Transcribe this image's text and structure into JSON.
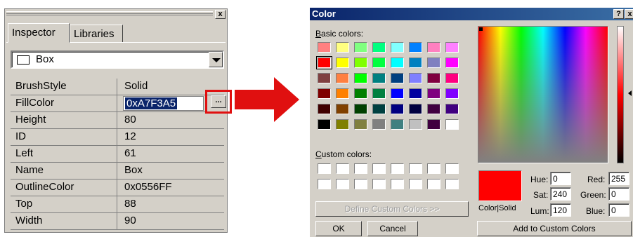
{
  "inspector": {
    "close_glyph": "x",
    "tabs": [
      {
        "label": "Inspector",
        "active": true
      },
      {
        "label": "Libraries",
        "active": false
      }
    ],
    "object_selector": {
      "value": "Box",
      "icon": "rectangle-icon"
    },
    "properties": [
      {
        "name": "BrushStyle",
        "value": "Solid"
      },
      {
        "name": "FillColor",
        "value": "0xA7F3A5",
        "editing": true
      },
      {
        "name": "Height",
        "value": "80"
      },
      {
        "name": "ID",
        "value": "12"
      },
      {
        "name": "Left",
        "value": "61"
      },
      {
        "name": "Name",
        "value": "Box"
      },
      {
        "name": "OutlineColor",
        "value": "0x0556FF"
      },
      {
        "name": "Top",
        "value": "88"
      },
      {
        "name": "Width",
        "value": "90"
      }
    ],
    "ellipsis_label": "...",
    "highlight_color": "#e01010"
  },
  "arrow_color": "#e01010",
  "color_dialog": {
    "title": "Color",
    "help_glyph": "?",
    "close_glyph": "x",
    "basic_colors_label": "Basic colors:",
    "custom_colors_label": "Custom colors:",
    "basic_colors": [
      [
        "#ff8080",
        "#ffff80",
        "#80ff80",
        "#00ff80",
        "#80ffff",
        "#0080ff",
        "#ff80c0",
        "#ff80ff"
      ],
      [
        "#ff0000",
        "#ffff00",
        "#80ff00",
        "#00ff40",
        "#00ffff",
        "#0080c0",
        "#8080c0",
        "#ff00ff"
      ],
      [
        "#804040",
        "#ff8040",
        "#00ff00",
        "#008080",
        "#004080",
        "#8080ff",
        "#800040",
        "#ff0080"
      ],
      [
        "#800000",
        "#ff8000",
        "#008000",
        "#008040",
        "#0000ff",
        "#0000a0",
        "#800080",
        "#8000ff"
      ],
      [
        "#400000",
        "#804000",
        "#004000",
        "#004040",
        "#000080",
        "#000040",
        "#400040",
        "#400080"
      ],
      [
        "#000000",
        "#808000",
        "#808040",
        "#808080",
        "#408080",
        "#c0c0c0",
        "#400040",
        "#ffffff"
      ]
    ],
    "selected_basic": "#ff0000",
    "custom_colors": [
      [
        "#ffffff",
        "#ffffff",
        "#ffffff",
        "#ffffff",
        "#ffffff",
        "#ffffff",
        "#ffffff",
        "#ffffff"
      ],
      [
        "#ffffff",
        "#ffffff",
        "#ffffff",
        "#ffffff",
        "#ffffff",
        "#ffffff",
        "#ffffff",
        "#ffffff"
      ]
    ],
    "define_custom_label": "Define Custom Colors >>",
    "ok_label": "OK",
    "cancel_label": "Cancel",
    "add_custom_label": "Add to Custom Colors",
    "color_solid_label": "Color|Solid",
    "current_color": "#ff0000",
    "fields": {
      "hue": {
        "label": "Hue:",
        "value": "0"
      },
      "sat": {
        "label": "Sat:",
        "value": "240"
      },
      "lum": {
        "label": "Lum:",
        "value": "120"
      },
      "red": {
        "label": "Red:",
        "value": "255"
      },
      "green": {
        "label": "Green:",
        "value": "0"
      },
      "blue": {
        "label": "Blue:",
        "value": "0"
      }
    }
  }
}
